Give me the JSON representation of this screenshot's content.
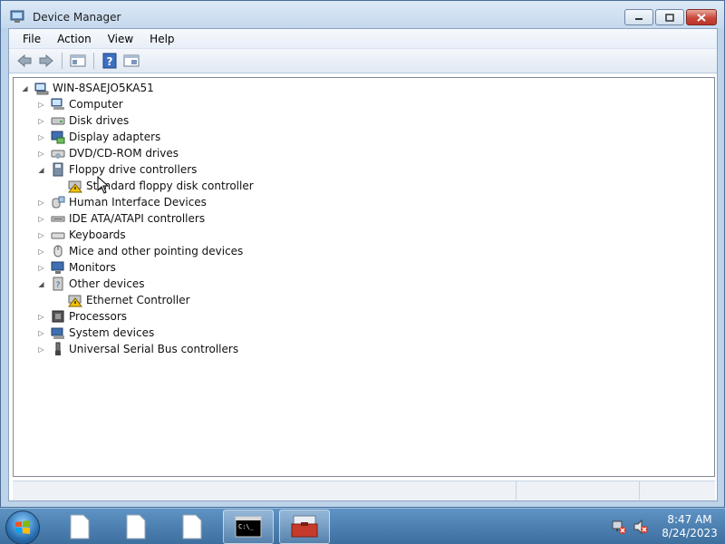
{
  "window": {
    "title": "Device Manager"
  },
  "menubar": {
    "items": [
      "File",
      "Action",
      "View",
      "Help"
    ]
  },
  "toolbar": {
    "buttons": [
      "back-icon",
      "forward-icon",
      "properties-icon",
      "help-icon",
      "show-hide-console-tree-icon"
    ]
  },
  "tree": {
    "root": "WIN-8SAEJO5KA51",
    "nodes": [
      {
        "label": "Computer",
        "icon": "computer-icon",
        "expanded": false,
        "depth": 1
      },
      {
        "label": "Disk drives",
        "icon": "disk-drive-icon",
        "expanded": false,
        "depth": 1
      },
      {
        "label": "Display adapters",
        "icon": "display-adapter-icon",
        "expanded": false,
        "depth": 1
      },
      {
        "label": "DVD/CD-ROM drives",
        "icon": "dvd-drive-icon",
        "expanded": false,
        "depth": 1
      },
      {
        "label": "Floppy drive controllers",
        "icon": "floppy-controller-icon",
        "expanded": true,
        "depth": 1
      },
      {
        "label": "Standard floppy disk controller",
        "icon": "warning-device-icon",
        "depth": 2
      },
      {
        "label": "Human Interface Devices",
        "icon": "hid-icon",
        "expanded": false,
        "depth": 1
      },
      {
        "label": "IDE ATA/ATAPI controllers",
        "icon": "ide-controller-icon",
        "expanded": false,
        "depth": 1
      },
      {
        "label": "Keyboards",
        "icon": "keyboard-icon",
        "expanded": false,
        "depth": 1
      },
      {
        "label": "Mice and other pointing devices",
        "icon": "mouse-icon",
        "expanded": false,
        "depth": 1
      },
      {
        "label": "Monitors",
        "icon": "monitor-icon",
        "expanded": false,
        "depth": 1
      },
      {
        "label": "Other devices",
        "icon": "other-devices-icon",
        "expanded": true,
        "depth": 1
      },
      {
        "label": "Ethernet Controller",
        "icon": "warning-device-icon",
        "depth": 2
      },
      {
        "label": "Processors",
        "icon": "processor-icon",
        "expanded": false,
        "depth": 1
      },
      {
        "label": "System devices",
        "icon": "system-devices-icon",
        "expanded": false,
        "depth": 1
      },
      {
        "label": "Universal Serial Bus controllers",
        "icon": "usb-icon",
        "expanded": false,
        "depth": 1
      }
    ]
  },
  "taskbar": {
    "pinned": [
      "document-icon",
      "document-icon",
      "document-icon",
      "cmd-icon",
      "device-manager-icon"
    ],
    "clock_time": "8:47 AM",
    "clock_date": "8/24/2023",
    "tray": [
      "network-icon",
      "volume-muted-icon"
    ]
  },
  "colors": {
    "accent": "#3d6f9f",
    "warning": "#f5c400"
  }
}
